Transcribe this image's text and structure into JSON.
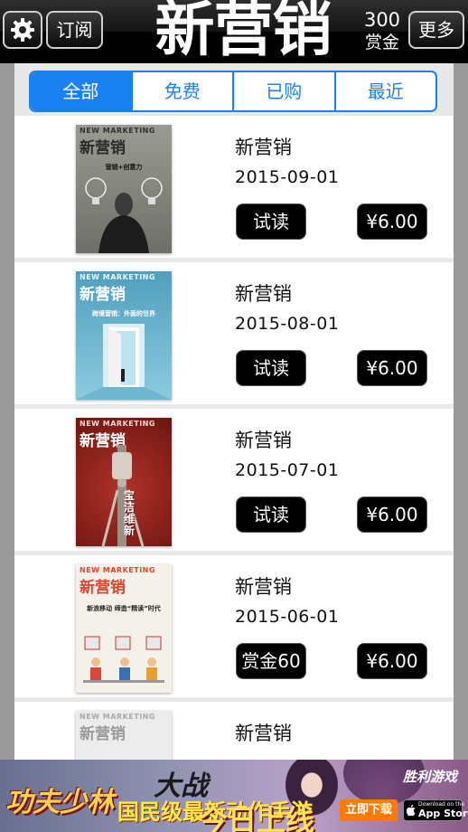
{
  "header": {
    "subscribe_label": "订阅",
    "title": "新营销",
    "bounty_count": "300",
    "bounty_label": "赏金",
    "more_label": "更多"
  },
  "tabs": [
    {
      "label": "全部",
      "active": true
    },
    {
      "label": "免费",
      "active": false
    },
    {
      "label": "已购",
      "active": false
    },
    {
      "label": "最近",
      "active": false
    }
  ],
  "issues": [
    {
      "name": "新营销",
      "date": "2015-09-01",
      "action": "试读",
      "price": "¥6.00",
      "cover": {
        "masthead": "NEW MARKETING",
        "logo": "新营销",
        "headline": "营销+创意力",
        "bg": "#8f9086",
        "logo_color": "#2b2b2b"
      }
    },
    {
      "name": "新营销",
      "date": "2015-08-01",
      "action": "试读",
      "price": "¥6.00",
      "cover": {
        "masthead": "NEW MARKETING",
        "logo": "新营销",
        "headline": "跨境营销：外面的世界",
        "bg": "#5aa7c2",
        "logo_color": "#ffffff"
      }
    },
    {
      "name": "新营销",
      "date": "2015-07-01",
      "action": "试读",
      "price": "¥6.00",
      "cover": {
        "masthead": "NEW MARKETING",
        "logo": "新营销",
        "headline": "宝洁维新",
        "bg": "#8e1f16",
        "logo_color": "#ffffff"
      }
    },
    {
      "name": "新营销",
      "date": "2015-06-01",
      "action": "赏金60",
      "price": "¥6.00",
      "cover": {
        "masthead": "NEW MARKETING",
        "logo": "新营销",
        "headline": "新浪移动 缔造“精读”时代",
        "bg": "#f2efe9",
        "logo_color": "#e0452f"
      }
    },
    {
      "name": "新营销",
      "date": "",
      "action": "",
      "price": "",
      "cover": {
        "masthead": "NEW MARKETING",
        "logo": "新营销",
        "headline": "",
        "bg": "#e6e6e6",
        "logo_color": "#9a9a9a"
      }
    }
  ],
  "ad": {
    "logo": "功夫少林",
    "headline_top": "大战",
    "headline_mid": "国民级最新动作手游",
    "headline_bottom": "今日上线",
    "brand": "胜利游戏",
    "download_label": "立即下载",
    "store_small": "Download on the",
    "store_big": "App Store"
  },
  "colors": {
    "accent": "#1a82f0",
    "topbar": "#000000",
    "button": "#000000"
  }
}
